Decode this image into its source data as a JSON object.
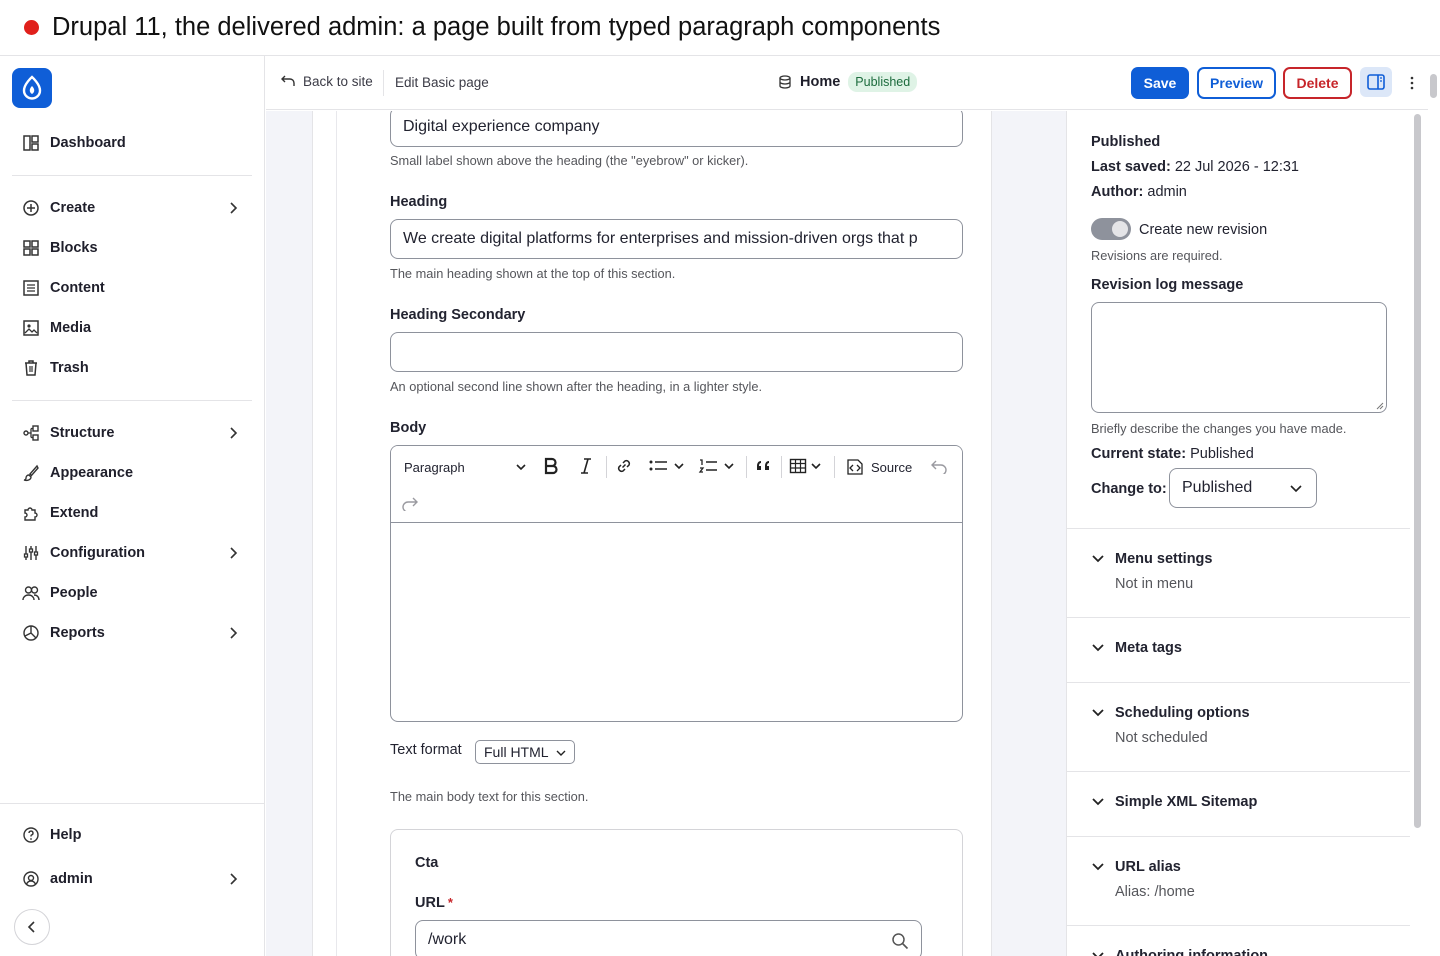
{
  "recording_title": "Drupal 11, the delivered admin: a page built from typed paragraph components",
  "sidebar": {
    "items": [
      {
        "label": "Dashboard"
      },
      {
        "label": "Create"
      },
      {
        "label": "Blocks"
      },
      {
        "label": "Content"
      },
      {
        "label": "Media"
      },
      {
        "label": "Trash"
      },
      {
        "label": "Structure"
      },
      {
        "label": "Appearance"
      },
      {
        "label": "Extend"
      },
      {
        "label": "Configuration"
      },
      {
        "label": "People"
      },
      {
        "label": "Reports"
      },
      {
        "label": "Help"
      },
      {
        "label": "admin"
      }
    ]
  },
  "topbar": {
    "back_label": "Back to site",
    "edit_label": "Edit Basic page",
    "node_title": "Home",
    "status_badge": "Published",
    "save_label": "Save",
    "preview_label": "Preview",
    "delete_label": "Delete"
  },
  "form": {
    "eyebrow_value": "Digital experience company",
    "eyebrow_desc": "Small label shown above the heading (the \"eyebrow\" or kicker).",
    "heading_label": "Heading",
    "heading_value": "We create digital platforms for enterprises and mission-driven orgs that p",
    "heading_desc": "The main heading shown at the top of this section.",
    "heading_secondary_label": "Heading Secondary",
    "heading_secondary_value": "",
    "heading_secondary_desc": "An optional second line shown after the heading, in a lighter style.",
    "body_label": "Body",
    "editor_paragraph": "Paragraph",
    "editor_source": "Source",
    "text_format_label": "Text format",
    "text_format_value": "Full HTML",
    "body_desc": "The main body text for this section.",
    "cta_title": "Cta",
    "url_label": "URL",
    "required_mark": "*",
    "url_value": "/work"
  },
  "meta": {
    "status": "Published",
    "last_saved_label": "Last saved:",
    "last_saved_value": "22 Jul 2026 - 12:31",
    "author_label": "Author:",
    "author_value": "admin",
    "new_revision_label": "Create new revision",
    "revisions_required": "Revisions are required.",
    "revision_log_label": "Revision log message",
    "revision_log_desc": "Briefly describe the changes you have made.",
    "current_state_label": "Current state:",
    "current_state_value": "Published",
    "change_to_label": "Change to:",
    "change_to_value": "Published",
    "sections": [
      {
        "title": "Menu settings",
        "summary": "Not in menu"
      },
      {
        "title": "Meta tags",
        "summary": ""
      },
      {
        "title": "Scheduling options",
        "summary": "Not scheduled"
      },
      {
        "title": "Simple XML Sitemap",
        "summary": ""
      },
      {
        "title": "URL alias",
        "summary": "Alias: /home"
      },
      {
        "title": "Authoring information",
        "summary": ""
      }
    ]
  },
  "colors": {
    "primary": "#0f5ed7",
    "danger": "#c7252a",
    "recording": "#e0201b",
    "badge_bg": "#dff3e6",
    "badge_text": "#1c6b3d"
  }
}
